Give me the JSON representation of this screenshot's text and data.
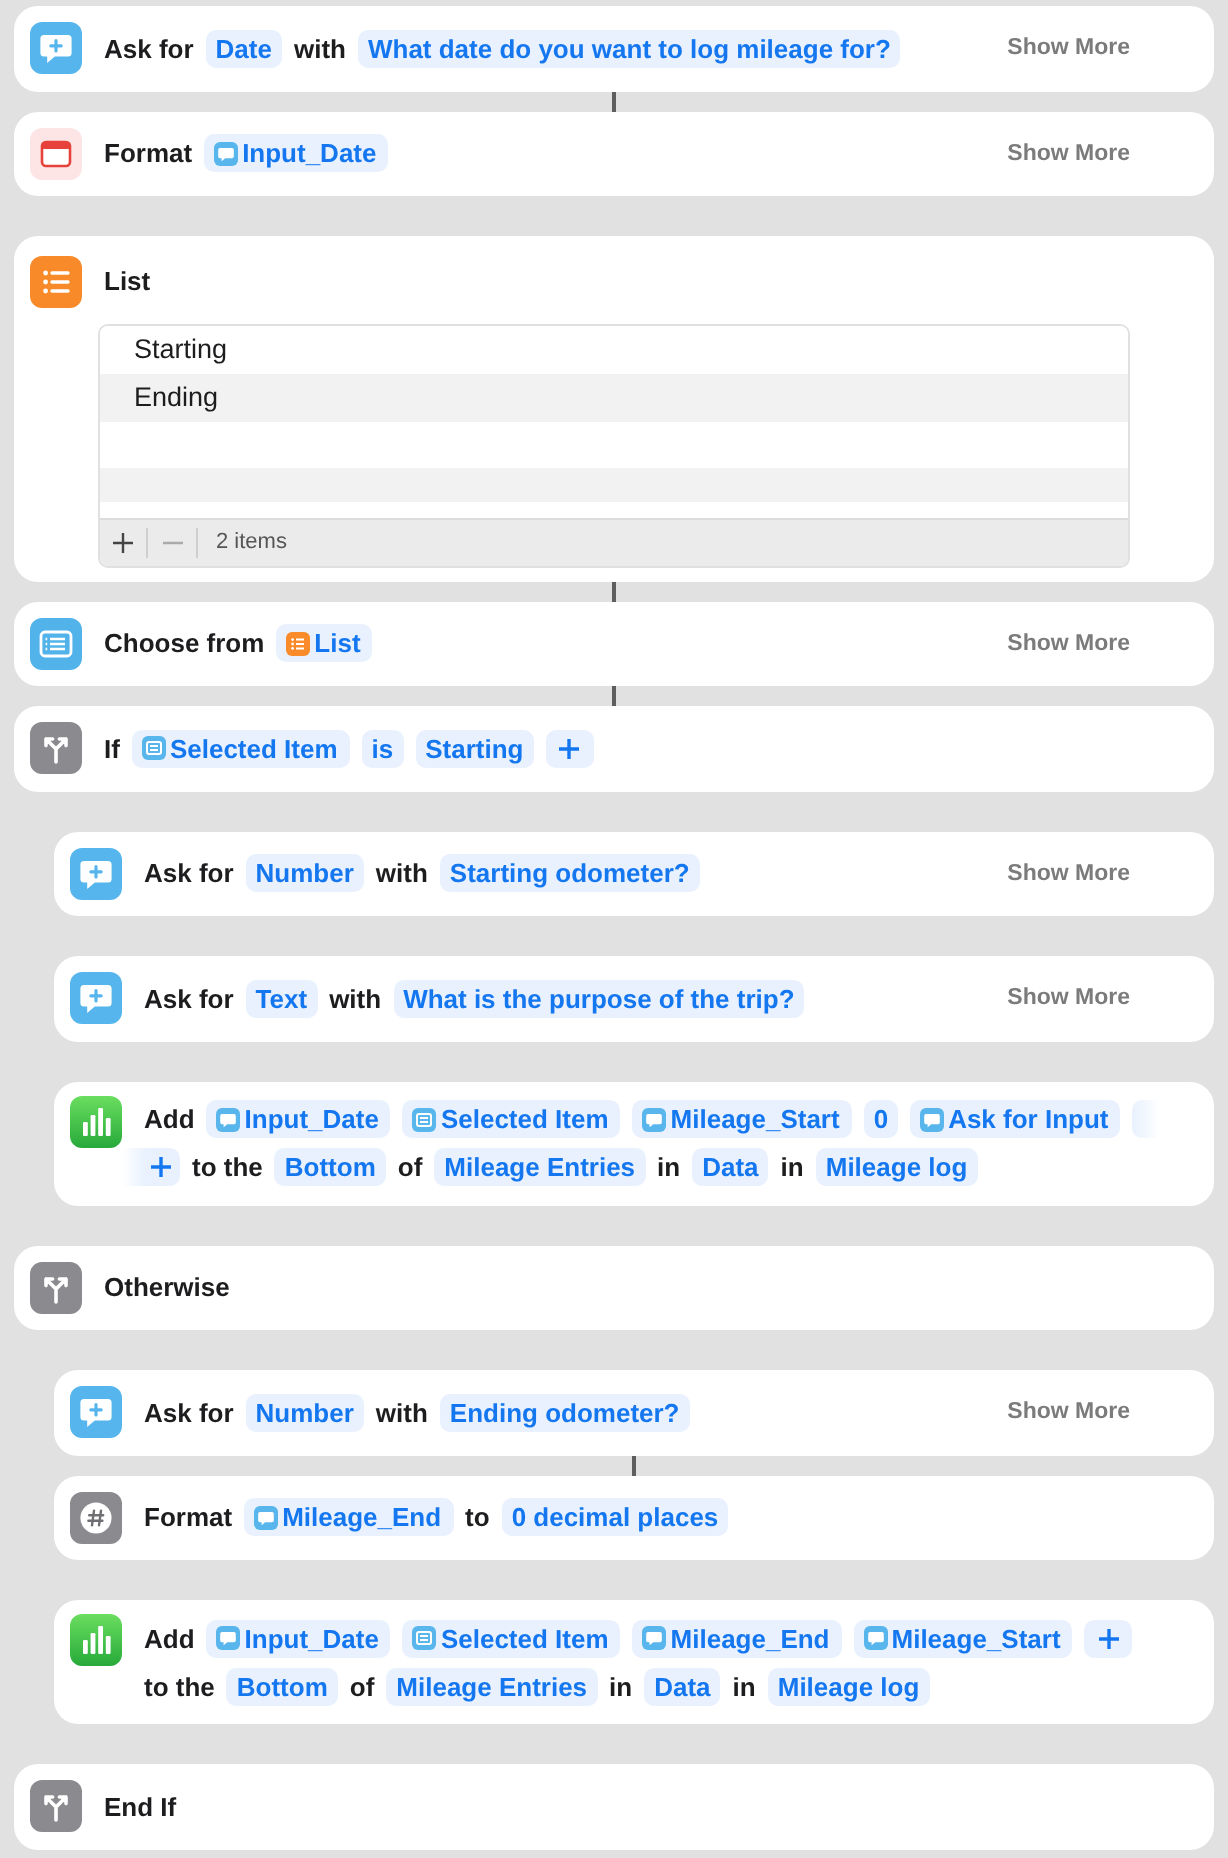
{
  "actions": [
    {
      "kind": "ask",
      "connected": true,
      "lines": [
        [
          {
            "kind": "label",
            "text": "Ask for"
          },
          {
            "kind": "token",
            "text": "Date"
          },
          {
            "kind": "label",
            "text": "with"
          },
          {
            "kind": "token",
            "text": "What date do you want to log mileage for?"
          }
        ]
      ],
      "show_more": "Show More"
    },
    {
      "kind": "format_date",
      "connected": false,
      "lines": [
        [
          {
            "kind": "label",
            "text": "Format"
          },
          {
            "kind": "var_ask",
            "text": "Input_Date"
          }
        ]
      ],
      "show_more": "Show More"
    },
    {
      "kind": "list",
      "connected": true,
      "lines": [
        [
          {
            "kind": "label",
            "text": "List"
          }
        ]
      ],
      "list": {
        "items": [
          "Starting",
          "Ending"
        ],
        "count": "2 items"
      }
    },
    {
      "kind": "choose",
      "connected": true,
      "lines": [
        [
          {
            "kind": "label",
            "text": "Choose from"
          },
          {
            "kind": "var_list",
            "text": "List"
          }
        ]
      ],
      "show_more": "Show More"
    },
    {
      "kind": "if",
      "connected": false,
      "lines": [
        [
          {
            "kind": "label",
            "text": "If"
          },
          {
            "kind": "var_choose",
            "text": "Selected Item"
          },
          {
            "kind": "token",
            "text": "is"
          },
          {
            "kind": "token",
            "text": "Starting"
          },
          {
            "kind": "plus",
            "faded": false
          }
        ]
      ],
      "children": [
        {
          "kind": "ask",
          "connected": false,
          "lines": [
            [
              {
                "kind": "label",
                "text": "Ask for"
              },
              {
                "kind": "token",
                "text": "Number"
              },
              {
                "kind": "label",
                "text": "with"
              },
              {
                "kind": "token",
                "text": "Starting odometer?"
              }
            ]
          ],
          "show_more": "Show More"
        },
        {
          "kind": "ask",
          "connected": false,
          "lines": [
            [
              {
                "kind": "label",
                "text": "Ask for"
              },
              {
                "kind": "token",
                "text": "Text"
              },
              {
                "kind": "label",
                "text": "with"
              },
              {
                "kind": "token",
                "text": "What is the purpose of the trip?"
              }
            ]
          ],
          "show_more": "Show More"
        },
        {
          "kind": "add_row",
          "connected": false,
          "lines": [
            [
              {
                "kind": "label",
                "text": "Add"
              },
              {
                "kind": "var_ask",
                "text": "Input_Date"
              },
              {
                "kind": "var_choose",
                "text": "Selected Item"
              },
              {
                "kind": "var_ask",
                "text": "Mileage_Start"
              },
              {
                "kind": "token",
                "text": "0"
              },
              {
                "kind": "var_ask",
                "text": "Ask for Input"
              },
              {
                "kind": "cut_off"
              }
            ],
            [
              {
                "kind": "plus",
                "faded": true
              },
              {
                "kind": "label",
                "text": "to the"
              },
              {
                "kind": "token",
                "text": "Bottom"
              },
              {
                "kind": "label",
                "text": "of"
              },
              {
                "kind": "token",
                "text": "Mileage Entries"
              },
              {
                "kind": "label",
                "text": "in"
              },
              {
                "kind": "token",
                "text": "Data"
              },
              {
                "kind": "label",
                "text": "in"
              },
              {
                "kind": "token",
                "text": "Mileage log"
              }
            ]
          ]
        }
      ]
    },
    {
      "kind": "otherwise",
      "connected": false,
      "lines": [
        [
          {
            "kind": "label",
            "text": "Otherwise"
          }
        ]
      ],
      "children": [
        {
          "kind": "ask",
          "connected": true,
          "lines": [
            [
              {
                "kind": "label",
                "text": "Ask for"
              },
              {
                "kind": "token",
                "text": "Number"
              },
              {
                "kind": "label",
                "text": "with"
              },
              {
                "kind": "token",
                "text": "Ending odometer?"
              }
            ]
          ],
          "show_more": "Show More"
        },
        {
          "kind": "format_number",
          "connected": false,
          "lines": [
            [
              {
                "kind": "label",
                "text": "Format"
              },
              {
                "kind": "var_ask",
                "text": "Mileage_End"
              },
              {
                "kind": "label",
                "text": "to"
              },
              {
                "kind": "token",
                "text": "0 decimal places"
              }
            ]
          ]
        },
        {
          "kind": "add_row",
          "connected": false,
          "lines": [
            [
              {
                "kind": "label",
                "text": "Add"
              },
              {
                "kind": "var_ask",
                "text": "Input_Date"
              },
              {
                "kind": "var_choose",
                "text": "Selected Item"
              },
              {
                "kind": "var_ask",
                "text": "Mileage_End"
              },
              {
                "kind": "var_ask",
                "text": "Mileage_Start"
              },
              {
                "kind": "plus",
                "faded": false
              }
            ],
            [
              {
                "kind": "label",
                "text": "to the"
              },
              {
                "kind": "token",
                "text": "Bottom"
              },
              {
                "kind": "label",
                "text": "of"
              },
              {
                "kind": "token",
                "text": "Mileage Entries"
              },
              {
                "kind": "label",
                "text": "in"
              },
              {
                "kind": "token",
                "text": "Data"
              },
              {
                "kind": "label",
                "text": "in"
              },
              {
                "kind": "token",
                "text": "Mileage log"
              }
            ]
          ]
        }
      ]
    },
    {
      "kind": "end_if",
      "connected": false,
      "lines": [
        [
          {
            "kind": "label",
            "text": "End If"
          }
        ]
      ]
    }
  ]
}
